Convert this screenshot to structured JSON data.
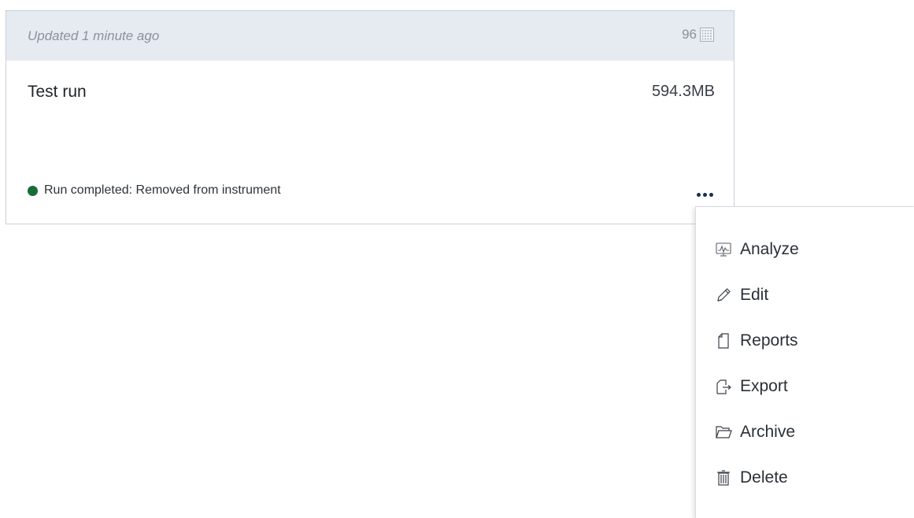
{
  "card": {
    "updated": "Updated 1 minute ago",
    "well_count": "96",
    "run_name": "Test run",
    "run_size": "594.3MB",
    "status_text": "Run completed: Removed from instrument",
    "status_color": "#1a6b3a"
  },
  "menu": {
    "items": [
      {
        "label": "Analyze",
        "icon": "analyze-icon"
      },
      {
        "label": "Edit",
        "icon": "pencil-icon"
      },
      {
        "label": "Reports",
        "icon": "document-icon"
      },
      {
        "label": "Export",
        "icon": "export-icon"
      },
      {
        "label": "Archive",
        "icon": "folder-icon"
      },
      {
        "label": "Delete",
        "icon": "trash-icon"
      }
    ]
  }
}
